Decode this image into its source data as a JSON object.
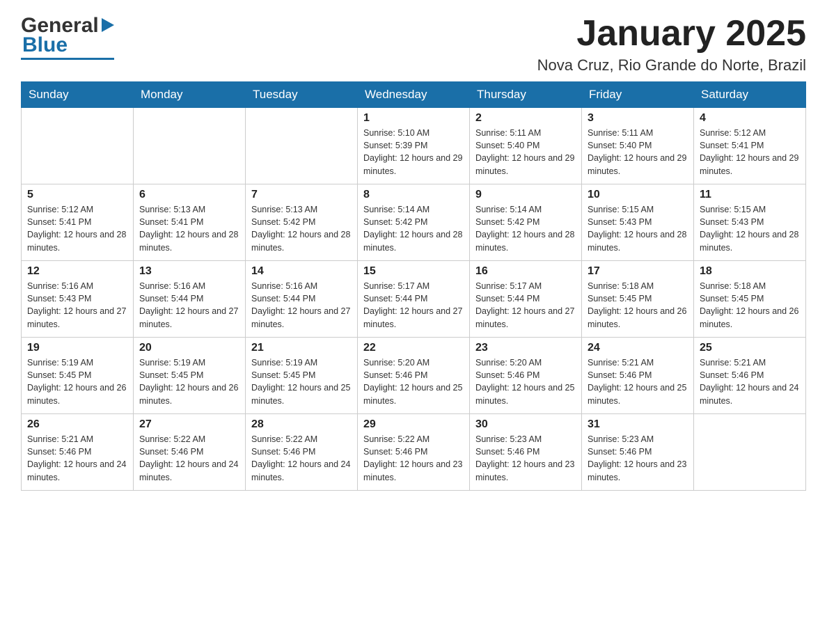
{
  "header": {
    "month_title": "January 2025",
    "location": "Nova Cruz, Rio Grande do Norte, Brazil",
    "logo_general": "General",
    "logo_blue": "Blue"
  },
  "days_of_week": [
    "Sunday",
    "Monday",
    "Tuesday",
    "Wednesday",
    "Thursday",
    "Friday",
    "Saturday"
  ],
  "weeks": [
    [
      {
        "day": "",
        "sunrise": "",
        "sunset": "",
        "daylight": ""
      },
      {
        "day": "",
        "sunrise": "",
        "sunset": "",
        "daylight": ""
      },
      {
        "day": "",
        "sunrise": "",
        "sunset": "",
        "daylight": ""
      },
      {
        "day": "1",
        "sunrise": "Sunrise: 5:10 AM",
        "sunset": "Sunset: 5:39 PM",
        "daylight": "Daylight: 12 hours and 29 minutes."
      },
      {
        "day": "2",
        "sunrise": "Sunrise: 5:11 AM",
        "sunset": "Sunset: 5:40 PM",
        "daylight": "Daylight: 12 hours and 29 minutes."
      },
      {
        "day": "3",
        "sunrise": "Sunrise: 5:11 AM",
        "sunset": "Sunset: 5:40 PM",
        "daylight": "Daylight: 12 hours and 29 minutes."
      },
      {
        "day": "4",
        "sunrise": "Sunrise: 5:12 AM",
        "sunset": "Sunset: 5:41 PM",
        "daylight": "Daylight: 12 hours and 29 minutes."
      }
    ],
    [
      {
        "day": "5",
        "sunrise": "Sunrise: 5:12 AM",
        "sunset": "Sunset: 5:41 PM",
        "daylight": "Daylight: 12 hours and 28 minutes."
      },
      {
        "day": "6",
        "sunrise": "Sunrise: 5:13 AM",
        "sunset": "Sunset: 5:41 PM",
        "daylight": "Daylight: 12 hours and 28 minutes."
      },
      {
        "day": "7",
        "sunrise": "Sunrise: 5:13 AM",
        "sunset": "Sunset: 5:42 PM",
        "daylight": "Daylight: 12 hours and 28 minutes."
      },
      {
        "day": "8",
        "sunrise": "Sunrise: 5:14 AM",
        "sunset": "Sunset: 5:42 PM",
        "daylight": "Daylight: 12 hours and 28 minutes."
      },
      {
        "day": "9",
        "sunrise": "Sunrise: 5:14 AM",
        "sunset": "Sunset: 5:42 PM",
        "daylight": "Daylight: 12 hours and 28 minutes."
      },
      {
        "day": "10",
        "sunrise": "Sunrise: 5:15 AM",
        "sunset": "Sunset: 5:43 PM",
        "daylight": "Daylight: 12 hours and 28 minutes."
      },
      {
        "day": "11",
        "sunrise": "Sunrise: 5:15 AM",
        "sunset": "Sunset: 5:43 PM",
        "daylight": "Daylight: 12 hours and 28 minutes."
      }
    ],
    [
      {
        "day": "12",
        "sunrise": "Sunrise: 5:16 AM",
        "sunset": "Sunset: 5:43 PM",
        "daylight": "Daylight: 12 hours and 27 minutes."
      },
      {
        "day": "13",
        "sunrise": "Sunrise: 5:16 AM",
        "sunset": "Sunset: 5:44 PM",
        "daylight": "Daylight: 12 hours and 27 minutes."
      },
      {
        "day": "14",
        "sunrise": "Sunrise: 5:16 AM",
        "sunset": "Sunset: 5:44 PM",
        "daylight": "Daylight: 12 hours and 27 minutes."
      },
      {
        "day": "15",
        "sunrise": "Sunrise: 5:17 AM",
        "sunset": "Sunset: 5:44 PM",
        "daylight": "Daylight: 12 hours and 27 minutes."
      },
      {
        "day": "16",
        "sunrise": "Sunrise: 5:17 AM",
        "sunset": "Sunset: 5:44 PM",
        "daylight": "Daylight: 12 hours and 27 minutes."
      },
      {
        "day": "17",
        "sunrise": "Sunrise: 5:18 AM",
        "sunset": "Sunset: 5:45 PM",
        "daylight": "Daylight: 12 hours and 26 minutes."
      },
      {
        "day": "18",
        "sunrise": "Sunrise: 5:18 AM",
        "sunset": "Sunset: 5:45 PM",
        "daylight": "Daylight: 12 hours and 26 minutes."
      }
    ],
    [
      {
        "day": "19",
        "sunrise": "Sunrise: 5:19 AM",
        "sunset": "Sunset: 5:45 PM",
        "daylight": "Daylight: 12 hours and 26 minutes."
      },
      {
        "day": "20",
        "sunrise": "Sunrise: 5:19 AM",
        "sunset": "Sunset: 5:45 PM",
        "daylight": "Daylight: 12 hours and 26 minutes."
      },
      {
        "day": "21",
        "sunrise": "Sunrise: 5:19 AM",
        "sunset": "Sunset: 5:45 PM",
        "daylight": "Daylight: 12 hours and 25 minutes."
      },
      {
        "day": "22",
        "sunrise": "Sunrise: 5:20 AM",
        "sunset": "Sunset: 5:46 PM",
        "daylight": "Daylight: 12 hours and 25 minutes."
      },
      {
        "day": "23",
        "sunrise": "Sunrise: 5:20 AM",
        "sunset": "Sunset: 5:46 PM",
        "daylight": "Daylight: 12 hours and 25 minutes."
      },
      {
        "day": "24",
        "sunrise": "Sunrise: 5:21 AM",
        "sunset": "Sunset: 5:46 PM",
        "daylight": "Daylight: 12 hours and 25 minutes."
      },
      {
        "day": "25",
        "sunrise": "Sunrise: 5:21 AM",
        "sunset": "Sunset: 5:46 PM",
        "daylight": "Daylight: 12 hours and 24 minutes."
      }
    ],
    [
      {
        "day": "26",
        "sunrise": "Sunrise: 5:21 AM",
        "sunset": "Sunset: 5:46 PM",
        "daylight": "Daylight: 12 hours and 24 minutes."
      },
      {
        "day": "27",
        "sunrise": "Sunrise: 5:22 AM",
        "sunset": "Sunset: 5:46 PM",
        "daylight": "Daylight: 12 hours and 24 minutes."
      },
      {
        "day": "28",
        "sunrise": "Sunrise: 5:22 AM",
        "sunset": "Sunset: 5:46 PM",
        "daylight": "Daylight: 12 hours and 24 minutes."
      },
      {
        "day": "29",
        "sunrise": "Sunrise: 5:22 AM",
        "sunset": "Sunset: 5:46 PM",
        "daylight": "Daylight: 12 hours and 23 minutes."
      },
      {
        "day": "30",
        "sunrise": "Sunrise: 5:23 AM",
        "sunset": "Sunset: 5:46 PM",
        "daylight": "Daylight: 12 hours and 23 minutes."
      },
      {
        "day": "31",
        "sunrise": "Sunrise: 5:23 AM",
        "sunset": "Sunset: 5:46 PM",
        "daylight": "Daylight: 12 hours and 23 minutes."
      },
      {
        "day": "",
        "sunrise": "",
        "sunset": "",
        "daylight": ""
      }
    ]
  ]
}
